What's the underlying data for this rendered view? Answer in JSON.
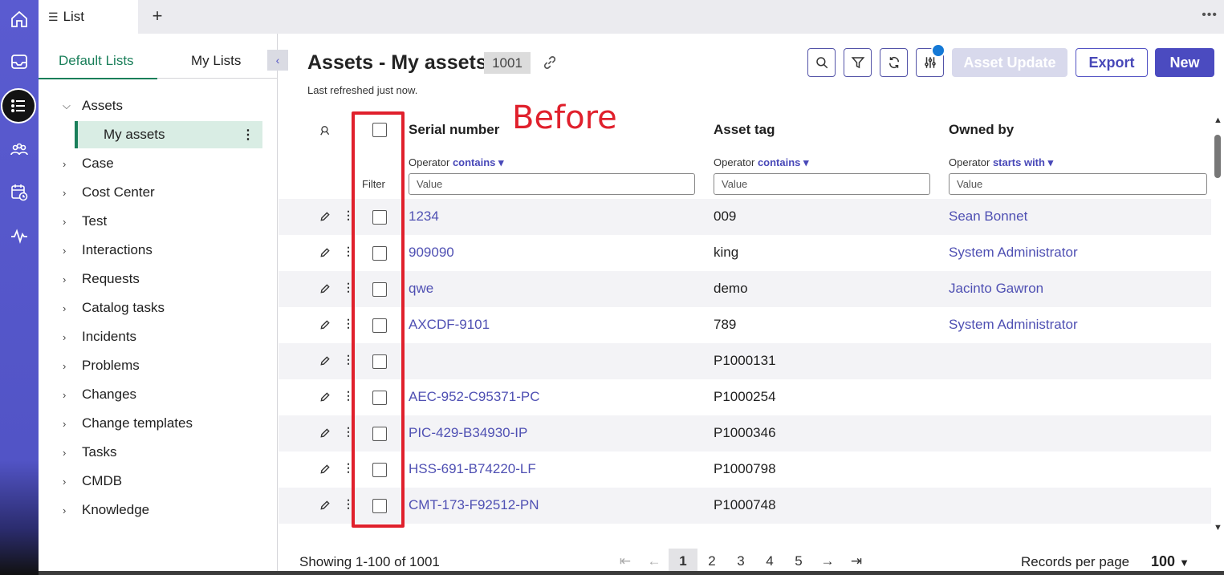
{
  "tabs": [
    {
      "label": "List",
      "icon": "menu-icon"
    }
  ],
  "sidebar": {
    "tabs": [
      "Default Lists",
      "My Lists"
    ],
    "tree": [
      {
        "label": "Assets",
        "expanded": true,
        "children": [
          {
            "label": "My assets",
            "selected": true
          }
        ]
      },
      {
        "label": "Case"
      },
      {
        "label": "Cost Center"
      },
      {
        "label": "Test"
      },
      {
        "label": "Interactions"
      },
      {
        "label": "Requests"
      },
      {
        "label": "Catalog tasks"
      },
      {
        "label": "Incidents"
      },
      {
        "label": "Problems"
      },
      {
        "label": "Changes"
      },
      {
        "label": "Change templates"
      },
      {
        "label": "Tasks"
      },
      {
        "label": "CMDB"
      },
      {
        "label": "Knowledge"
      }
    ]
  },
  "header": {
    "title": "Assets - My assets",
    "count": "1001",
    "refreshed": "Last refreshed just now.",
    "buttons": {
      "asset_update": "Asset Update",
      "export": "Export",
      "new": "New"
    }
  },
  "grid": {
    "filter_label": "Filter",
    "columns": [
      {
        "label": "Serial number",
        "operator_label": "Operator",
        "operator": "contains",
        "placeholder": "Value"
      },
      {
        "label": "Asset tag",
        "operator_label": "Operator",
        "operator": "contains",
        "placeholder": "Value"
      },
      {
        "label": "Owned by",
        "operator_label": "Operator",
        "operator": "starts with",
        "placeholder": "Value"
      }
    ],
    "rows": [
      {
        "serial": "1234",
        "tag": "009",
        "owner": "Sean Bonnet"
      },
      {
        "serial": "909090",
        "tag": "king",
        "owner": "System Administrator"
      },
      {
        "serial": "qwe",
        "tag": "demo",
        "owner": "Jacinto Gawron"
      },
      {
        "serial": "AXCDF-9101",
        "tag": "789",
        "owner": "System Administrator"
      },
      {
        "serial": "",
        "tag": "P1000131",
        "owner": ""
      },
      {
        "serial": "AEC-952-C95371-PC",
        "tag": "P1000254",
        "owner": ""
      },
      {
        "serial": "PIC-429-B34930-IP",
        "tag": "P1000346",
        "owner": ""
      },
      {
        "serial": "HSS-691-B74220-LF",
        "tag": "P1000798",
        "owner": ""
      },
      {
        "serial": "CMT-173-F92512-PN",
        "tag": "P1000748",
        "owner": ""
      }
    ]
  },
  "annotation": {
    "text": "Before",
    "color": "#e0202c"
  },
  "footer": {
    "showing": "Showing 1-100 of 1001",
    "pages": [
      "1",
      "2",
      "3",
      "4",
      "5"
    ],
    "current_page": "1",
    "records_label": "Records per page",
    "records_value": "100"
  },
  "colors": {
    "accent": "#4b4bc0",
    "rail": "#5254c6",
    "link": "#4f50b3",
    "selected_green": "#1a7f5a"
  }
}
